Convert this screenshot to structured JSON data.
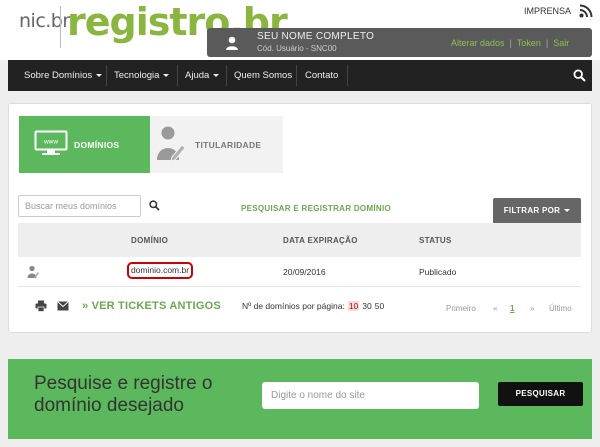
{
  "header": {
    "logo_nic": "nic.br",
    "logo_registro": "registro.br",
    "press_label": "IMPRENSA",
    "rss_icon": "rss-icon"
  },
  "user": {
    "name": "SEU NOME COMPLETO",
    "code": "Cód. Usuário - SNC00",
    "links": [
      "Alterar dados",
      "Token",
      "Sair"
    ]
  },
  "nav": {
    "items": [
      {
        "label": "Sobre Domínios",
        "dropdown": true
      },
      {
        "label": "Tecnologia",
        "dropdown": true
      },
      {
        "label": "Ajuda",
        "dropdown": true
      },
      {
        "label": "Quem Somos",
        "dropdown": false
      },
      {
        "label": "Contato",
        "dropdown": false
      }
    ],
    "search_icon": "search-icon"
  },
  "tabs": {
    "domains": {
      "label": "DOMÍNIOS",
      "icon_text": "www"
    },
    "ownership": {
      "label": "TITULARIDADE"
    }
  },
  "toolbar": {
    "search_placeholder": "Buscar meus domínios",
    "search_link": "PESQUISAR E REGISTRAR DOMÍNIO",
    "filter_label": "FILTRAR POR"
  },
  "table": {
    "columns": [
      "DOMÍNIO",
      "DATA EXPIRAÇÃO",
      "STATUS"
    ],
    "rows": [
      {
        "domain": "dominio.com.br",
        "expiration": "20/09/2016",
        "status": "Publicado"
      }
    ]
  },
  "footer": {
    "old_tickets": "» VER TICKETS ANTIGOS",
    "per_page_label": "Nº de domínios por página:",
    "per_page_options": [
      "10",
      "30",
      "50"
    ],
    "per_page_selected": "10",
    "pager": {
      "first": "Primeiro",
      "prev": "«",
      "current": "1",
      "next": "»",
      "last": "Último"
    }
  },
  "banner": {
    "title": "Pesquise e registre o domínio desejado",
    "input_placeholder": "Digite o nome do site",
    "button_label": "PESQUISAR"
  },
  "colors": {
    "green": "#5cb85c",
    "link_green": "#6aa84f",
    "nav_dark": "#222222",
    "highlight_red": "#cc0000"
  }
}
